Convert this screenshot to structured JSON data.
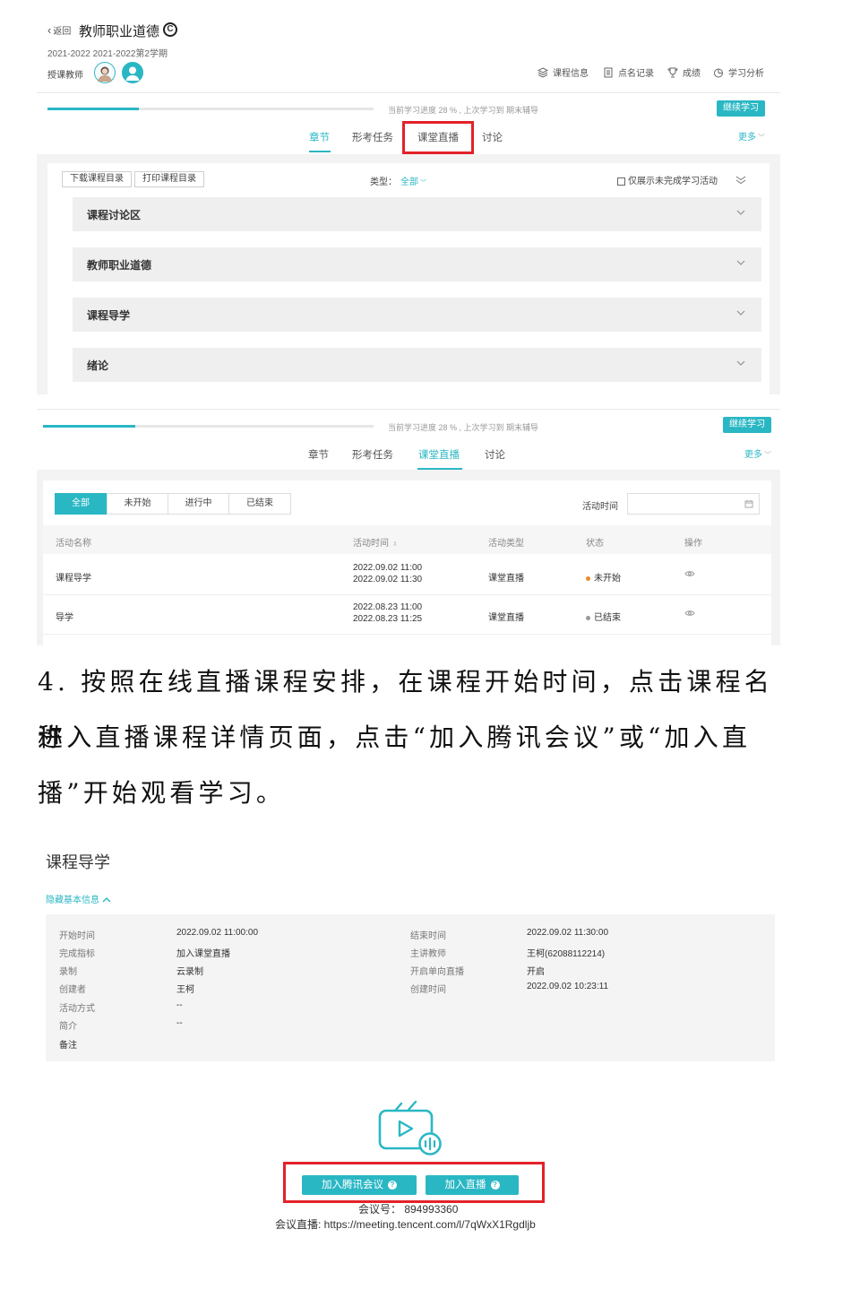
{
  "panel1": {
    "back_label": "返回",
    "course_title": "教师职业道德",
    "term": "2021-2022 2021-2022第2学期",
    "teacher_label": "授课教师",
    "top_menu": [
      "课程信息",
      "点名记录",
      "成绩",
      "学习分析"
    ],
    "progress_percent": 28,
    "progress_text": "当前学习进度 28 % , 上次学习到 期末辅导",
    "continue_label": "继续学习",
    "tabs": [
      "章节",
      "形考任务",
      "课堂直播",
      "讨论"
    ],
    "more_label": "更多",
    "download_label": "下载课程目录",
    "print_label": "打印课程目录",
    "type_label": "类型：",
    "type_value": "全部",
    "only_incomplete_label": "仅展示未完成学习活动",
    "chapters": [
      "课程讨论区",
      "教师职业道德",
      "课程导学",
      "绪论"
    ]
  },
  "panel2": {
    "progress_percent": 28,
    "progress_text": "当前学习进度 28 % , 上次学习到 期末辅导",
    "continue_label": "继续学习",
    "tabs": [
      "章节",
      "形考任务",
      "课堂直播",
      "讨论"
    ],
    "more_label": "更多",
    "filters": [
      "全部",
      "未开始",
      "进行中",
      "已结束"
    ],
    "activity_time_label": "活动时间",
    "columns": [
      "活动名称",
      "活动时间",
      "活动类型",
      "状态",
      "操作"
    ],
    "rows": [
      {
        "name": "课程导学",
        "start": "2022.09.02 11:00",
        "end": "2022.09.02 11:30",
        "type": "课堂直播",
        "status": "未开始",
        "status_color": "#f08a24"
      },
      {
        "name": "导学",
        "start": "2022.08.23 11:00",
        "end": "2022.08.23 11:25",
        "type": "课堂直播",
        "status": "已结束",
        "status_color": "#999999"
      }
    ]
  },
  "paragraph": {
    "line1": "4. 按照在线直播课程安排，在课程开始时间，点击课程名称",
    "line2": "进入直播课程详情页面，点击“加入腾讯会议”或“加入直",
    "line3": "播”开始观看学习。"
  },
  "detail": {
    "title": "课程导学",
    "hide_info_label": "隐藏基本信息",
    "left_info": [
      {
        "k": "开始时间",
        "v": "2022.09.02 11:00:00"
      },
      {
        "k": "完成指标",
        "v": "加入课堂直播"
      },
      {
        "k": "录制",
        "v": "云录制"
      },
      {
        "k": "创建者",
        "v": "王柯"
      },
      {
        "k": "活动方式",
        "v": "--"
      },
      {
        "k": "简介",
        "v": "--"
      },
      {
        "k": "备注",
        "v": ""
      }
    ],
    "right_info": [
      {
        "k": "结束时间",
        "v": "2022.09.02 11:30:00"
      },
      {
        "k": "主讲教师",
        "v": "王柯(62088112214)"
      },
      {
        "k": "开启单向直播",
        "v": "开启"
      },
      {
        "k": "创建时间",
        "v": "2022.09.02 10:23:11"
      }
    ],
    "join_tencent_label": "加入腾讯会议",
    "join_live_label": "加入直播",
    "meeting_id_line": "会议号： 894993360",
    "meeting_link_line": "会议直播: https://meeting.tencent.com/l/7qWxX1Rgdljb"
  },
  "colors": {
    "accent": "#2ab7c4",
    "highlight_box": "#e3222a"
  }
}
